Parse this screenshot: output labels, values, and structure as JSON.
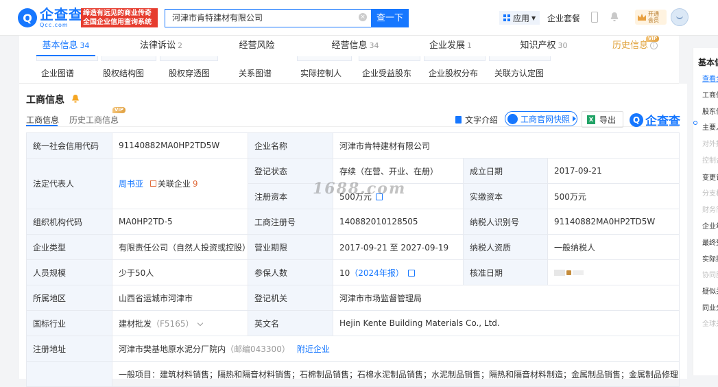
{
  "header": {
    "logo_mark": "Q",
    "logo_cn": "企查查",
    "logo_en": "Qcc.com",
    "slogan_line1": "缔造有远见的商业传奇",
    "slogan_line2": "全国企业信用查询系统",
    "search_value": "河津市肯特建材有限公司",
    "search_button": "查一下",
    "app_menu": "应用",
    "plan": "企业套餐",
    "member_line1": "开通",
    "member_line2": "会员"
  },
  "nav_tabs": [
    {
      "label": "基本信息",
      "count": "34"
    },
    {
      "label": "法律诉讼",
      "count": "2"
    },
    {
      "label": "经营风险",
      "count": ""
    },
    {
      "label": "经营信息",
      "count": "34"
    },
    {
      "label": "企业发展",
      "count": "1"
    },
    {
      "label": "知识产权",
      "count": "30"
    },
    {
      "label": "历史信息",
      "count": ""
    }
  ],
  "vip": "VIP",
  "sub_tools": [
    "企业图谱",
    "股权结构图",
    "股权穿透图",
    "关系图谱",
    "实际控制人",
    "企业受益股东",
    "企业股权分布",
    "关联方认定图"
  ],
  "section": {
    "title": "工商信息",
    "tabs": [
      "工商信息",
      "历史工商信息"
    ],
    "text_intro": "文字介绍",
    "quick_snapshot": "工商官网快照",
    "export": "导出",
    "brand_mark": "Q",
    "brand_text": "企查查"
  },
  "info": {
    "credit_code_label": "统一社会信用代码",
    "credit_code": "91140882MA0HP2TD5W",
    "company_name_label": "企业名称",
    "company_name": "河津市肯特建材有限公司",
    "legal_rep_label": "法定代表人",
    "legal_rep": "周书亚",
    "related_label": "关联企业",
    "related_count": "9",
    "status_label": "登记状态",
    "status": "存续（在营、开业、在册）",
    "founded_label": "成立日期",
    "founded": "2017-09-21",
    "reg_capital_label": "注册资本",
    "reg_capital": "500万元",
    "paid_capital_label": "实缴资本",
    "paid_capital": "500万元",
    "org_code_label": "组织机构代码",
    "org_code": "MA0HP2TD-5",
    "reg_no_label": "工商注册号",
    "reg_no": "140882010128505",
    "taxpayer_id_label": "纳税人识别号",
    "taxpayer_id": "91140882MA0HP2TD5W",
    "type_label": "企业类型",
    "type": "有限责任公司（自然人投资或控股）",
    "term_label": "营业期限",
    "term": "2017-09-21 至 2027-09-19",
    "taxpayer_qual_label": "纳税人资质",
    "taxpayer_qual": "一般纳税人",
    "staff_label": "人员规模",
    "staff": "少于50人",
    "insured_label": "参保人数",
    "insured": "10",
    "insured_year": "（2024年报）",
    "approved_label": "核准日期",
    "region_label": "所属地区",
    "region": "山西省运城市河津市",
    "authority_label": "登记机关",
    "authority": "河津市市场监督管理局",
    "industry_label": "国标行业",
    "industry": "建材批发",
    "industry_code": "（F5165）",
    "en_name_label": "英文名",
    "en_name": "Hejin Kente Building Materials Co., Ltd.",
    "address_label": "注册地址",
    "address": "河津市樊基地原水泥分厂院内",
    "postcode": "（邮编043300）",
    "nearby": "附近企业",
    "scope": "一般项目：建筑材料销售；隔热和隔音材料销售；石棉制品销售；石棉水泥制品销售；水泥制品销售；隔热和隔音材料制造；金属制品销售；金属制品修理；有色金"
  },
  "watermark": "1688.com",
  "right_nav": {
    "head": "基本信",
    "items": [
      {
        "label": "查看全",
        "state": "active"
      },
      {
        "label": "工商信",
        "state": "normal"
      },
      {
        "label": "股东信",
        "state": "normal"
      },
      {
        "label": "主要人",
        "state": "normal"
      },
      {
        "label": "对外投",
        "state": "disabled"
      },
      {
        "label": "控制企",
        "state": "disabled"
      },
      {
        "label": "变更记",
        "state": "normal"
      },
      {
        "label": "分支机",
        "state": "disabled"
      },
      {
        "label": "财务简",
        "state": "disabled"
      },
      {
        "label": "企业年",
        "state": "normal"
      },
      {
        "label": "最终受",
        "state": "normal"
      },
      {
        "label": "实际控",
        "state": "normal"
      },
      {
        "label": "协同股",
        "state": "disabled"
      },
      {
        "label": "疑似关",
        "state": "normal"
      },
      {
        "label": "同业分",
        "state": "normal"
      },
      {
        "label": "全球关",
        "state": "disabled"
      }
    ]
  }
}
